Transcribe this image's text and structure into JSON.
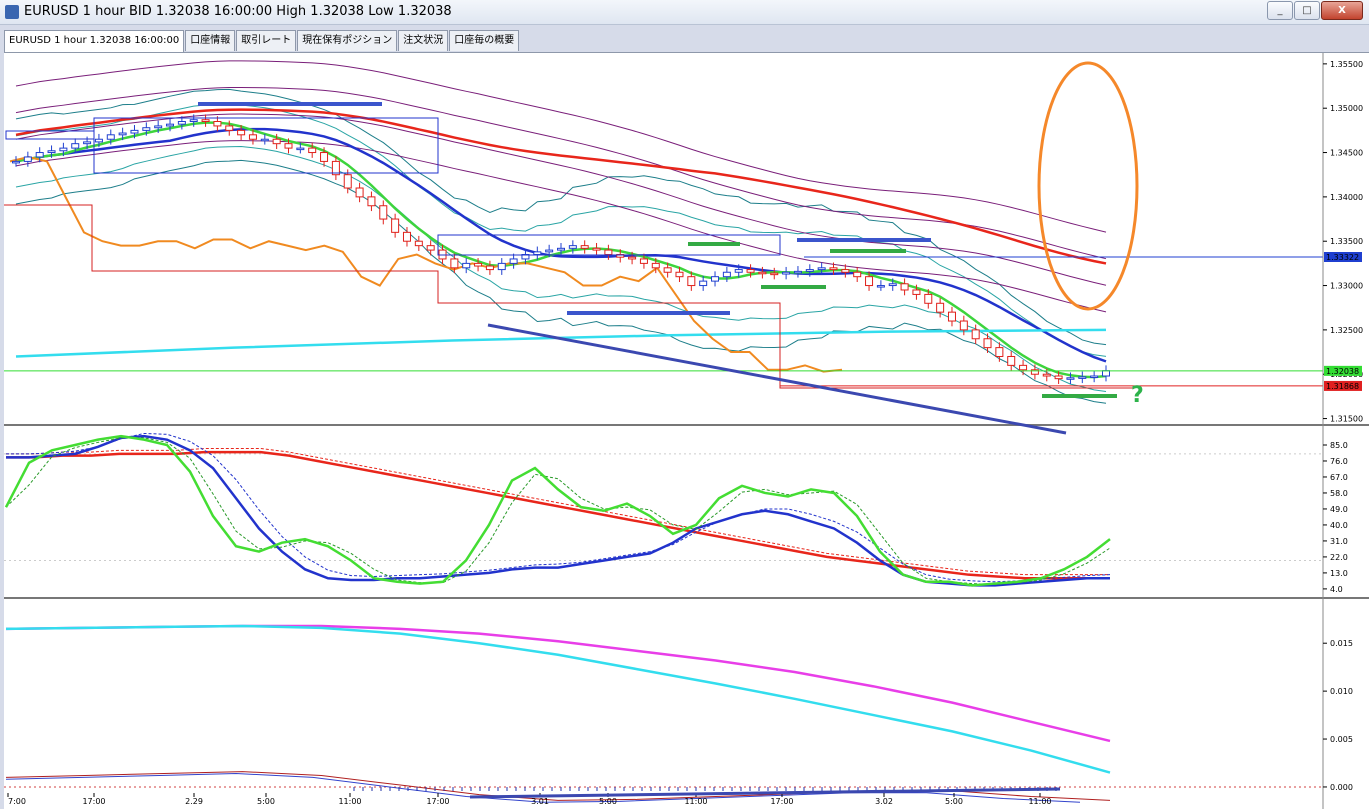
{
  "window": {
    "title": "EURUSD 1 hour BID 1.32038 16:00:00 High 1.32038 Low 1.32038",
    "buttons": [
      "_",
      "□",
      "X"
    ]
  },
  "tabs": [
    {
      "label": "EURUSD 1 hour 1.32038 16:00:00",
      "active": true
    },
    {
      "label": "口座情報",
      "active": false
    },
    {
      "label": "取引レート",
      "active": false
    },
    {
      "label": "現在保有ポジション",
      "active": false
    },
    {
      "label": "注文状況",
      "active": false
    },
    {
      "label": "口座毎の概要",
      "active": false
    }
  ],
  "annotation": {
    "question_mark": "?"
  },
  "colors": {
    "sma_red": "#e8261b",
    "sma_blue": "#2233cc",
    "sma_green": "#3dd43d",
    "line_orange": "#f08a20",
    "stoch_green": "#44dd33",
    "macd_magenta": "#e83ee8",
    "macd_cyan": "#33ddee",
    "bollinger": "#7a1f7a",
    "annot_orange": "#f5882a",
    "annot_blue_bar": "#3b55cc",
    "annot_green_bar": "#33aa44"
  },
  "chart_data": [
    {
      "type": "candlestick",
      "panel": "price",
      "symbol": "EURUSD",
      "timeframe": "1 hour",
      "y_ticks": [
        "1.35500",
        "1.35000",
        "1.34500",
        "1.34000",
        "1.33500",
        "1.33000",
        "1.32500",
        "1.32000",
        "1.31500"
      ],
      "ylim": [
        1.3145,
        1.356
      ],
      "price_labels": [
        {
          "label": "1.33322",
          "value": 1.33322,
          "color": "#1f3fd0"
        },
        {
          "label": "1.32038",
          "value": 1.32038,
          "color": "#33dd33"
        },
        {
          "label": "1.31868",
          "value": 1.31868,
          "color": "#e02020"
        }
      ],
      "x_labels": [
        "7:00",
        "17:00",
        "2.29",
        "5:00",
        "11:00",
        "17:00",
        "3.01",
        "5:00",
        "11:00",
        "17:00",
        "3.02",
        "5:00",
        "11:00"
      ],
      "closes": [
        1.344,
        1.3445,
        1.345,
        1.3452,
        1.3455,
        1.346,
        1.3462,
        1.3465,
        1.347,
        1.3472,
        1.3475,
        1.3478,
        1.348,
        1.3482,
        1.3485,
        1.3487,
        1.3485,
        1.348,
        1.3475,
        1.347,
        1.3465,
        1.3465,
        1.346,
        1.3455,
        1.3455,
        1.345,
        1.344,
        1.3425,
        1.341,
        1.34,
        1.339,
        1.3375,
        1.336,
        1.335,
        1.3345,
        1.334,
        1.333,
        1.332,
        1.3325,
        1.3322,
        1.3318,
        1.3325,
        1.333,
        1.3335,
        1.3338,
        1.334,
        1.3342,
        1.3345,
        1.3342,
        1.334,
        1.3335,
        1.3332,
        1.333,
        1.3325,
        1.332,
        1.3315,
        1.331,
        1.33,
        1.3305,
        1.331,
        1.3315,
        1.3318,
        1.3315,
        1.3314,
        1.3313,
        1.3315,
        1.3316,
        1.3318,
        1.332,
        1.3318,
        1.3315,
        1.331,
        1.33,
        1.33,
        1.3302,
        1.3295,
        1.329,
        1.328,
        1.327,
        1.326,
        1.325,
        1.324,
        1.323,
        1.322,
        1.321,
        1.3205,
        1.32,
        1.3198,
        1.3195,
        1.3196,
        1.3197,
        1.3198,
        1.3204
      ]
    },
    {
      "type": "line",
      "panel": "stochastic",
      "y_ticks": [
        "85.0",
        "76.0",
        "67.0",
        "58.0",
        "49.0",
        "40.0",
        "31.0",
        "22.0",
        "13.0",
        "4.0"
      ],
      "ylim": [
        0,
        94
      ],
      "series": [
        {
          "color": "#44dd33",
          "values": [
            50,
            75,
            82,
            85,
            88,
            90,
            88,
            85,
            70,
            45,
            28,
            25,
            30,
            32,
            28,
            20,
            10,
            8,
            7,
            8,
            20,
            40,
            65,
            72,
            60,
            50,
            48,
            52,
            45,
            35,
            40,
            55,
            62,
            58,
            56,
            60,
            58,
            45,
            25,
            12,
            8,
            8,
            6,
            7,
            8,
            10,
            15,
            22,
            32
          ]
        },
        {
          "color": "#2233cc",
          "values": [
            78,
            78,
            79,
            80,
            84,
            89,
            90,
            88,
            82,
            72,
            55,
            38,
            25,
            15,
            10,
            9,
            9,
            10,
            10,
            11,
            12,
            13,
            15,
            16,
            16,
            18,
            20,
            22,
            24,
            30,
            38,
            42,
            46,
            48,
            46,
            42,
            38,
            30,
            20,
            12,
            8,
            7,
            6,
            6,
            7,
            8,
            9,
            10,
            10
          ]
        },
        {
          "color": "#e8261b",
          "values": [
            78,
            78,
            79,
            79,
            80,
            80,
            80,
            81,
            81,
            81,
            79,
            76,
            73,
            70,
            67,
            64,
            61,
            58,
            55,
            52,
            49,
            46,
            43,
            40,
            37,
            34,
            31,
            28,
            25,
            22,
            20,
            18,
            16,
            14,
            12,
            11,
            10,
            10,
            10,
            10
          ]
        }
      ]
    },
    {
      "type": "line",
      "panel": "macd",
      "y_ticks": [
        "0.015",
        "0.010",
        "0.005",
        "0.000"
      ],
      "ylim": [
        -0.0023,
        0.0193
      ],
      "series": [
        {
          "color": "#e83ee8",
          "values": [
            0.0165,
            0.0166,
            0.0167,
            0.0168,
            0.0168,
            0.0165,
            0.016,
            0.0152,
            0.0142,
            0.0132,
            0.012,
            0.0105,
            0.0088,
            0.0068,
            0.0048
          ]
        },
        {
          "color": "#33ddee",
          "values": [
            0.0165,
            0.0166,
            0.0167,
            0.0168,
            0.0166,
            0.016,
            0.015,
            0.0138,
            0.0123,
            0.0108,
            0.0092,
            0.0075,
            0.0058,
            0.0038,
            0.0015
          ]
        },
        {
          "color": "#b02020",
          "values": [
            0.0008,
            0.001,
            0.0012,
            0.0014,
            0.001,
            0.0,
            -0.001,
            -0.0016,
            -0.0015,
            -0.0012,
            -0.0009,
            -0.0006,
            -0.0006,
            -0.0012,
            -0.0016
          ]
        }
      ]
    }
  ]
}
